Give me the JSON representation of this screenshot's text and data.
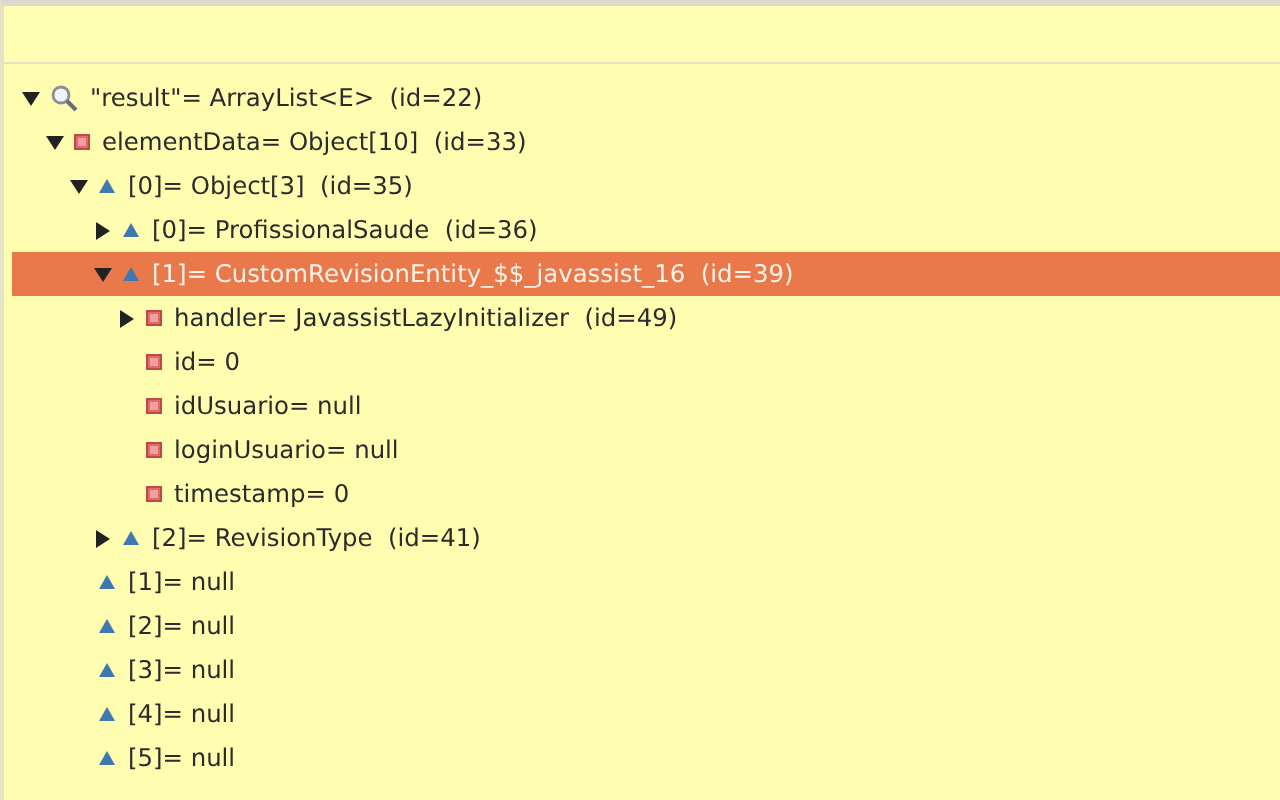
{
  "tree": [
    {
      "label": "\"result\"= ArrayList<E>  (id=22)",
      "kind": "search",
      "expanded": true,
      "selected": false,
      "children": [
        {
          "label": "elementData= Object[10]  (id=33)",
          "kind": "field",
          "expanded": true,
          "selected": false,
          "children": [
            {
              "label": "[0]= Object[3]  (id=35)",
              "kind": "element",
              "expanded": true,
              "selected": false,
              "children": [
                {
                  "label": "[0]= ProfissionalSaude  (id=36)",
                  "kind": "element",
                  "expanded": false,
                  "selected": false
                },
                {
                  "label": "[1]= CustomRevisionEntity_$$_javassist_16  (id=39)",
                  "kind": "element",
                  "expanded": true,
                  "selected": true,
                  "children": [
                    {
                      "label": "handler= JavassistLazyInitializer  (id=49)",
                      "kind": "field",
                      "expanded": false,
                      "selected": false
                    },
                    {
                      "label": "id= 0",
                      "kind": "field",
                      "selected": false
                    },
                    {
                      "label": "idUsuario= null",
                      "kind": "field",
                      "selected": false
                    },
                    {
                      "label": "loginUsuario= null",
                      "kind": "field",
                      "selected": false
                    },
                    {
                      "label": "timestamp= 0",
                      "kind": "field",
                      "selected": false
                    }
                  ]
                },
                {
                  "label": "[2]= RevisionType  (id=41)",
                  "kind": "element",
                  "expanded": false,
                  "selected": false
                }
              ]
            },
            {
              "label": "[1]= null",
              "kind": "element",
              "selected": false
            },
            {
              "label": "[2]= null",
              "kind": "element",
              "selected": false
            },
            {
              "label": "[3]= null",
              "kind": "element",
              "selected": false
            },
            {
              "label": "[4]= null",
              "kind": "element",
              "selected": false
            },
            {
              "label": "[5]= null",
              "kind": "element",
              "selected": false
            }
          ]
        }
      ]
    }
  ]
}
